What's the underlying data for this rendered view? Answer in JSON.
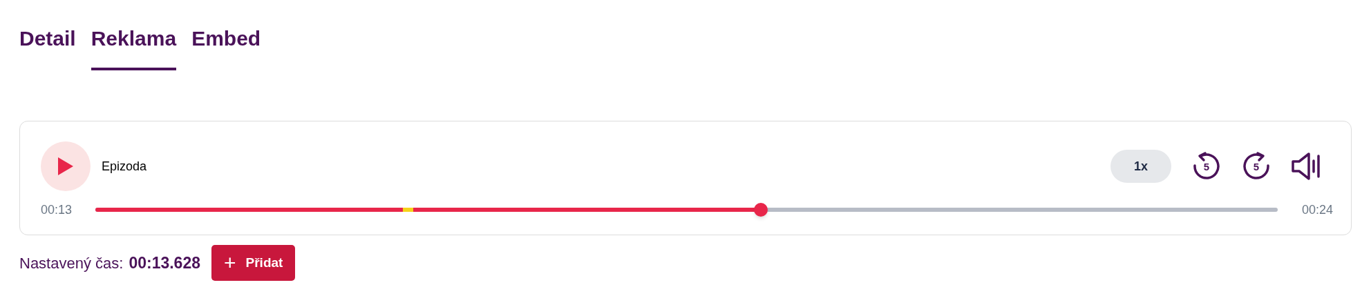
{
  "tabs": [
    {
      "label": "Detail",
      "selected": false
    },
    {
      "label": "Reklama",
      "selected": true
    },
    {
      "label": "Embed",
      "selected": false
    }
  ],
  "player": {
    "title": "Epizoda",
    "speed": "1x",
    "rewind_label": "5",
    "forward_label": "5",
    "current_time": "00:13",
    "total_time": "00:24",
    "level": 0.563,
    "markers": [
      {
        "level": 0.26
      }
    ]
  },
  "set_time": {
    "label": "Nastavený čas:",
    "value": "00:13.628"
  },
  "add_button": {
    "icon": "+",
    "label": "Přidat"
  }
}
